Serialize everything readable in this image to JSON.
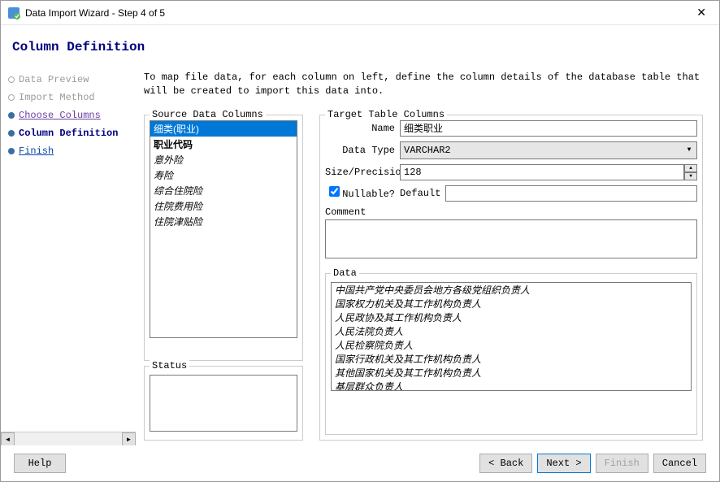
{
  "window": {
    "title": "Data Import Wizard - Step 4 of 5"
  },
  "header": {
    "title": "Column Definition"
  },
  "steps": [
    {
      "label": "Data Preview",
      "state": "disabled"
    },
    {
      "label": "Import Method",
      "state": "disabled"
    },
    {
      "label": "Choose Columns",
      "state": "done"
    },
    {
      "label": "Column Definition",
      "state": "current"
    },
    {
      "label": "Finish",
      "state": "next"
    }
  ],
  "intro": "To map file data, for each column on left, define the column details of the database table that will be created to import this data into.",
  "source": {
    "legend": "Source Data Columns",
    "items": [
      {
        "label": "细类(职业)",
        "selected": true
      },
      {
        "label": "职业代码",
        "bold": true
      },
      {
        "label": "意外险"
      },
      {
        "label": "寿险"
      },
      {
        "label": "综合住院险"
      },
      {
        "label": "住院费用险"
      },
      {
        "label": "住院津贴险"
      }
    ]
  },
  "status": {
    "legend": "Status"
  },
  "target": {
    "legend": "Target Table Columns",
    "name_label": "Name",
    "name_value": "细类职业",
    "datatype_label": "Data Type",
    "datatype_value": "VARCHAR2",
    "size_label": "Size/Precision",
    "size_value": "128",
    "nullable_label": "Nullable?",
    "nullable_checked": true,
    "default_label": "Default",
    "default_value": "",
    "comment_label": "Comment",
    "data_legend": "Data",
    "data_items": [
      "中国共产党中央委员会地方各级党组织负责人",
      "国家权力机关及其工作机构负责人",
      "人民政协及其工作机构负责人",
      "人民法院负责人",
      "人民检察院负责人",
      "国家行政机关及其工作机构负责人",
      "其他国家机关及其工作机构负责人",
      "基层群众负责人"
    ]
  },
  "footer": {
    "help": "Help",
    "back": "< Back",
    "next": "Next >",
    "finish": "Finish",
    "cancel": "Cancel"
  }
}
